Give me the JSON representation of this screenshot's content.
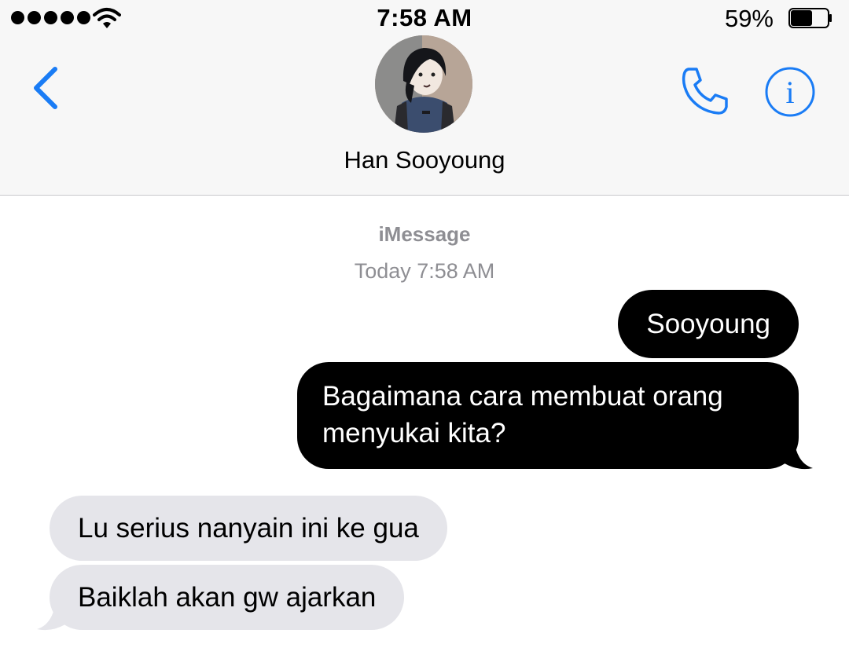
{
  "status_bar": {
    "time": "7:58 AM",
    "battery_percent": "59%",
    "battery_level": 0.59,
    "signal_bars": 5,
    "icons": [
      "signal-dots-icon",
      "wifi-icon",
      "battery-icon"
    ]
  },
  "header": {
    "contact_name": "Han Sooyoung",
    "icons": [
      "chevron-left-icon",
      "phone-icon",
      "info-icon"
    ]
  },
  "colors": {
    "accent": "#1a7cf5",
    "outgoing_bubble": "#000000",
    "incoming_bubble": "#e5e5ea",
    "meta_text": "#8e8e93"
  },
  "conversation": {
    "service": "iMessage",
    "timestamp": "Today 7:58 AM",
    "messages": [
      {
        "direction": "outgoing",
        "text": "Sooyoung"
      },
      {
        "direction": "outgoing",
        "text": "Bagaimana cara membuat orang menyukai kita?"
      },
      {
        "direction": "incoming",
        "text": "Lu serius nanyain ini ke gua"
      },
      {
        "direction": "incoming",
        "text": "Baiklah akan gw ajarkan"
      }
    ]
  }
}
